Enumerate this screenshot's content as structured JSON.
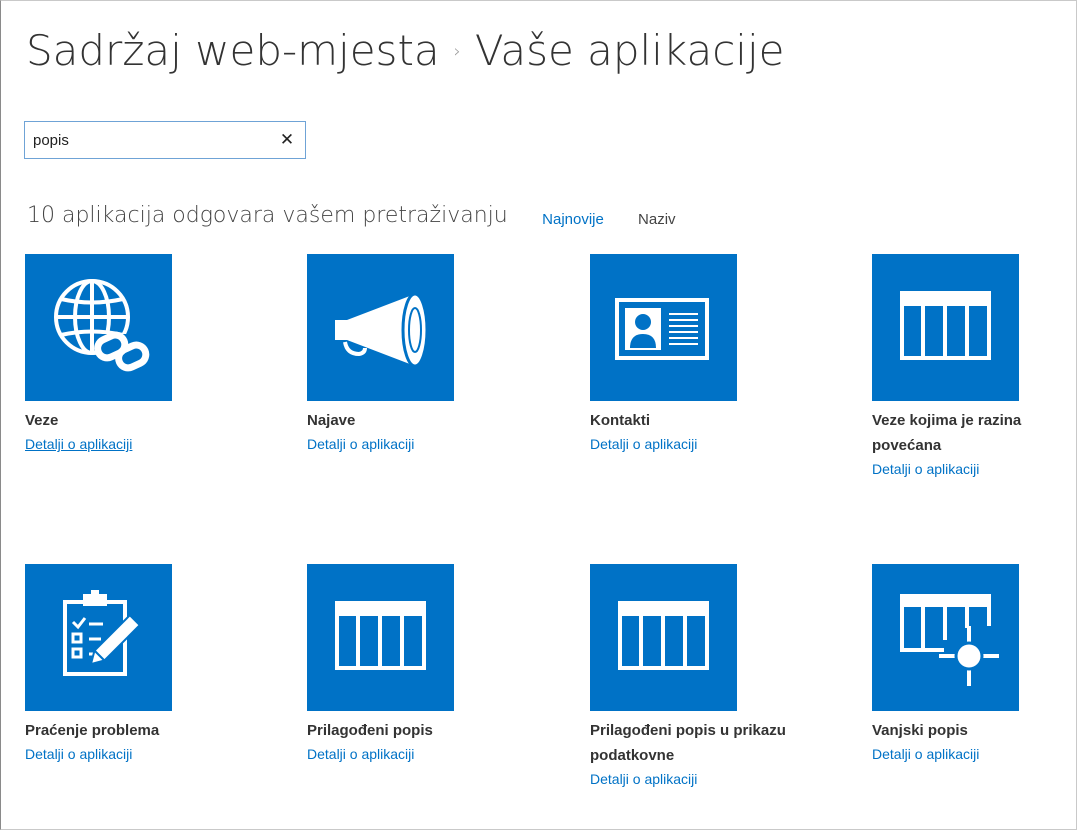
{
  "breadcrumb": {
    "site_contents": "Sadržaj web-mjesta",
    "separator": "›",
    "your_apps": "Vaše aplikacije"
  },
  "search": {
    "value": "popis",
    "clear_glyph": "✕"
  },
  "results": {
    "summary": "10 aplikacija odgovara vašem pretraživanju",
    "sort_newest": "Najnovije",
    "sort_name": "Naziv"
  },
  "theme": {
    "tile_color": "#0072c6",
    "link_color": "#0072c6"
  },
  "apps": [
    {
      "name": "Veze",
      "details": "Detalji o aplikaciji",
      "icon": "globe-link-icon"
    },
    {
      "name": "Najave",
      "details": "Detalji o aplikaciji",
      "icon": "megaphone-icon"
    },
    {
      "name": "Kontakti",
      "details": "Detalji o aplikaciji",
      "icon": "contact-card-icon"
    },
    {
      "name": "Veze kojima je razina povećana",
      "details": "Detalji o aplikaciji",
      "icon": "list-table-icon"
    },
    {
      "name": "Praćenje problema",
      "details": "Detalji o aplikaciji",
      "icon": "clipboard-checklist-icon"
    },
    {
      "name": "Prilagođeni popis",
      "details": "Detalji o aplikaciji",
      "icon": "list-table-icon"
    },
    {
      "name": "Prilagođeni popis u prikazu podatkovne",
      "details": "Detalji o aplikaciji",
      "icon": "list-table-icon"
    },
    {
      "name": "Vanjski popis",
      "details": "Detalji o aplikaciji",
      "icon": "external-list-icon"
    }
  ]
}
